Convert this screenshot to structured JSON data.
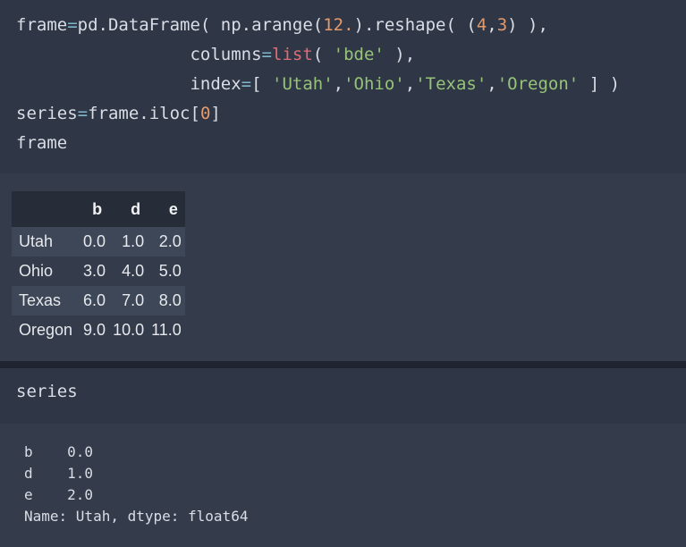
{
  "code_cell": {
    "line1": {
      "a": "frame",
      "b": "=",
      "c": "pd.DataFrame( np.arange(",
      "d": "12.",
      "e": ").reshape( (",
      "f": "4",
      "g": ",",
      "h": "3",
      "i": ") ),"
    },
    "line2": {
      "a": "                 columns",
      "b": "=",
      "c": "list",
      "d": "( ",
      "e": "'bde'",
      "f": " ),"
    },
    "line3": {
      "a": "                 index",
      "b": "=",
      "c": "[ ",
      "d": "'Utah'",
      "e": ",",
      "f": "'Ohio'",
      "g": ",",
      "h": "'Texas'",
      "i": ",",
      "j": "'Oregon'",
      "k": " ] )"
    },
    "line4": {
      "a": "series",
      "b": "=",
      "c": "frame.iloc[",
      "d": "0",
      "e": "]"
    },
    "line5": "frame"
  },
  "dataframe": {
    "columns": [
      "",
      "b",
      "d",
      "e"
    ],
    "rows": [
      {
        "index": "Utah",
        "values": [
          "0.0",
          "1.0",
          "2.0"
        ]
      },
      {
        "index": "Ohio",
        "values": [
          "3.0",
          "4.0",
          "5.0"
        ]
      },
      {
        "index": "Texas",
        "values": [
          "6.0",
          "7.0",
          "8.0"
        ]
      },
      {
        "index": "Oregon",
        "values": [
          "9.0",
          "10.0",
          "11.0"
        ]
      }
    ]
  },
  "series_cell": {
    "command": "series"
  },
  "series_output": {
    "lines": [
      "b    0.0",
      "d    1.0",
      "e    2.0",
      "Name: Utah, dtype: float64"
    ]
  },
  "colors": {
    "background": "#2b3240",
    "input_bg": "#2f3645",
    "output_bg": "#343c4c",
    "string": "#97c379",
    "number": "#e39a6c",
    "operator": "#7fb6c9",
    "builtin": "#e06c75"
  }
}
